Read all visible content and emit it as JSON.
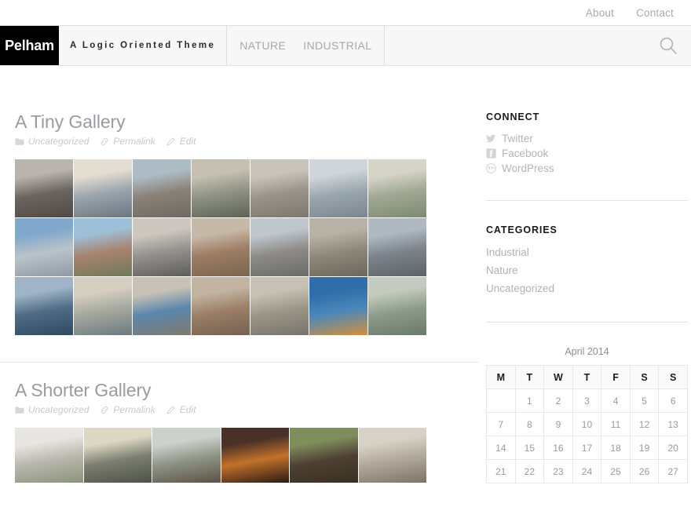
{
  "topnav": {
    "items": [
      {
        "label": "About",
        "name": "topnav-item-about"
      },
      {
        "label": "Contact",
        "name": "topnav-item-contact"
      }
    ]
  },
  "header": {
    "brand": "Pelham",
    "tagline": "A Logic Oriented Theme",
    "nav": [
      {
        "label": "NATURE",
        "name": "nav-item-nature"
      },
      {
        "label": "INDUSTRIAL",
        "name": "nav-item-industrial"
      }
    ],
    "search_icon": "search-icon"
  },
  "posts": [
    {
      "title": "A Tiny Gallery",
      "meta": {
        "category_icon": "folder-icon",
        "category": "Uncategorized",
        "permalink_icon": "link-icon",
        "permalink": "Permalink",
        "edit_icon": "pencil-icon",
        "edit": "Edit"
      },
      "columns": 7,
      "tiles": [
        {
          "alt": "hazy city skyline aerial",
          "c1": "#b9b4ae",
          "c2": "#6b6560",
          "c3": "#4e4a46"
        },
        {
          "alt": "power plant smokestacks",
          "c1": "#e3ddd2",
          "c2": "#9aa4ac",
          "c3": "#6a7682"
        },
        {
          "alt": "steel mill waterfront",
          "c1": "#aebcc6",
          "c2": "#8a8177",
          "c3": "#6d6a62"
        },
        {
          "alt": "stadium aerial view",
          "c1": "#c5c0b2",
          "c2": "#8f9285",
          "c3": "#5e6356"
        },
        {
          "alt": "urban rooftops aerial",
          "c1": "#c9c4bb",
          "c2": "#9a938a",
          "c3": "#7d776e"
        },
        {
          "alt": "glass office building",
          "c1": "#cfd5d9",
          "c2": "#9aa6ae",
          "c3": "#7b858c"
        },
        {
          "alt": "river highway landscape",
          "c1": "#d6d3c8",
          "c2": "#9fa893",
          "c3": "#7d8a73"
        },
        {
          "alt": "parking lot aerial",
          "c1": "#7fa8cc",
          "c2": "#b9c3ca",
          "c3": "#8e9aa2"
        },
        {
          "alt": "city blocks aerial",
          "c1": "#9dc0d8",
          "c2": "#a8826c",
          "c3": "#6e7a5c"
        },
        {
          "alt": "skyline across water",
          "c1": "#cdc7bf",
          "c2": "#93918c",
          "c3": "#5d5d5c"
        },
        {
          "alt": "waterfront apartments",
          "c1": "#c7b9a8",
          "c2": "#9d7d63",
          "c3": "#7a6450"
        },
        {
          "alt": "dense coastal city",
          "c1": "#bfc6cc",
          "c2": "#8d8b86",
          "c3": "#6a6b68"
        },
        {
          "alt": "industrial port aerial",
          "c1": "#b8b2a6",
          "c2": "#8f877b",
          "c3": "#6c665c"
        },
        {
          "alt": "downtown harbor view",
          "c1": "#aeb9c2",
          "c2": "#7c838a",
          "c3": "#5b6268"
        },
        {
          "alt": "highway interchange",
          "c1": "#9fb4c6",
          "c2": "#4f6b85",
          "c3": "#2f4a63"
        },
        {
          "alt": "power station chimney",
          "c1": "#d6cfc1",
          "c2": "#a5a89e",
          "c3": "#6d7a80"
        },
        {
          "alt": "lake shore plant",
          "c1": "#c8c2b6",
          "c2": "#5b87ad",
          "c3": "#7f7a6e"
        },
        {
          "alt": "riverside apartments",
          "c1": "#c3b4a2",
          "c2": "#9b7f66",
          "c3": "#766050"
        },
        {
          "alt": "suburban grid aerial",
          "c1": "#c6c1b4",
          "c2": "#9b9689",
          "c3": "#76746a"
        },
        {
          "alt": "shipping cranes",
          "c1": "#2f6ea8",
          "c2": "#4a87ba",
          "c3": "#d4903f"
        },
        {
          "alt": "glass tower facade",
          "c1": "#c2cbbd",
          "c2": "#8d9c8a",
          "c3": "#6a7a68"
        }
      ]
    },
    {
      "title": "A Shorter Gallery",
      "meta": {
        "category_icon": "folder-icon",
        "category": "Uncategorized",
        "permalink_icon": "link-icon",
        "permalink": "Permalink",
        "edit_icon": "pencil-icon",
        "edit": "Edit"
      },
      "columns": 6,
      "tiles": [
        {
          "alt": "snow covered ivy",
          "c1": "#e8e6e0",
          "c2": "#b9b7ae",
          "c3": "#8a9479"
        },
        {
          "alt": "cloudy sunset field",
          "c1": "#ddd8c4",
          "c2": "#7b7e70",
          "c3": "#4e5247"
        },
        {
          "alt": "frosted leaves",
          "c1": "#ccd2cb",
          "c2": "#8e9486",
          "c3": "#5b5246"
        },
        {
          "alt": "firelit cave wall",
          "c1": "#4a3128",
          "c2": "#c2712a",
          "c3": "#2a1b14"
        },
        {
          "alt": "green grass tangle",
          "c1": "#7f8f5c",
          "c2": "#4e4033",
          "c3": "#38301f"
        },
        {
          "alt": "pale lichen rock",
          "c1": "#d8d2c6",
          "c2": "#b0a89a",
          "c3": "#7d7468"
        }
      ]
    }
  ],
  "sidebar": {
    "connect": {
      "title": "CONNECT",
      "items": [
        {
          "label": "Twitter",
          "icon": "twitter-icon"
        },
        {
          "label": "Facebook",
          "icon": "facebook-icon"
        },
        {
          "label": "WordPress",
          "icon": "wordpress-icon"
        }
      ]
    },
    "categories": {
      "title": "CATEGORIES",
      "items": [
        {
          "label": "Industrial"
        },
        {
          "label": "Nature"
        },
        {
          "label": "Uncategorized"
        }
      ]
    },
    "calendar": {
      "caption": "April 2014",
      "daynames": [
        "M",
        "T",
        "W",
        "T",
        "F",
        "S",
        "S"
      ],
      "weeks": [
        [
          "",
          "1",
          "2",
          "3",
          "4",
          "5",
          "6"
        ],
        [
          "7",
          "8",
          "9",
          "10",
          "11",
          "12",
          "13"
        ],
        [
          "14",
          "15",
          "16",
          "17",
          "18",
          "19",
          "20"
        ],
        [
          "21",
          "22",
          "23",
          "24",
          "25",
          "26",
          "27"
        ]
      ]
    }
  }
}
